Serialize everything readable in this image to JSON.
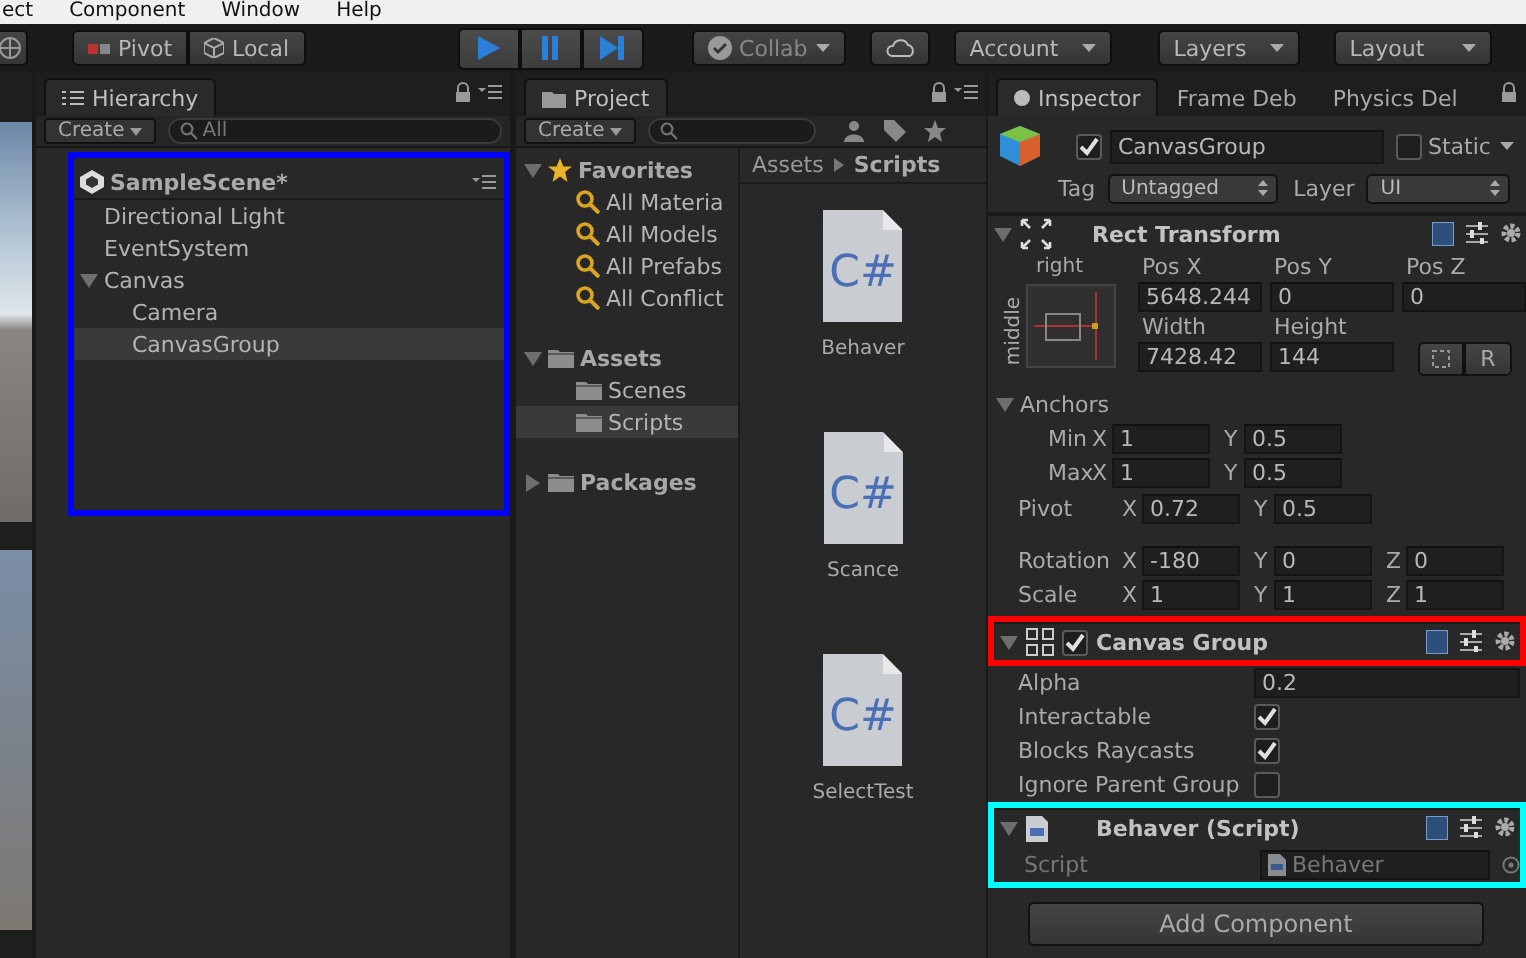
{
  "menu_bar": [
    "ect",
    "Component",
    "Window",
    "Help"
  ],
  "toolbar": {
    "pivot": "Pivot",
    "space": "Local",
    "play_controls": [
      {
        "kind": "play"
      },
      {
        "kind": "pause"
      },
      {
        "kind": "step"
      }
    ],
    "collab": "Collab",
    "account": "Account",
    "layers": "Layers",
    "layout": "Layout"
  },
  "hierarchy": {
    "tab": "Hierarchy",
    "create": "Create",
    "search_placeholder": "All",
    "scene": "SampleScene*",
    "items": [
      {
        "label": "Directional Light",
        "selected": false
      },
      {
        "label": "EventSystem",
        "selected": false
      },
      {
        "label": "Canvas",
        "selected": false,
        "expanded": true,
        "children": [
          {
            "label": "Camera",
            "selected": false
          },
          {
            "label": "CanvasGroup",
            "selected": true
          }
        ]
      }
    ]
  },
  "project": {
    "tab": "Project",
    "create": "Create",
    "tree": [
      {
        "label": "Favorites",
        "kind": "favorites",
        "selected": false,
        "expanded": true,
        "children": [
          {
            "label": "All Materia",
            "kind": "search",
            "selected": false
          },
          {
            "label": "All Models",
            "kind": "search",
            "selected": false
          },
          {
            "label": "All Prefabs",
            "kind": "search",
            "selected": false
          },
          {
            "label": "All Conflict",
            "kind": "search",
            "selected": false
          }
        ]
      },
      {
        "label": "Assets",
        "kind": "folder",
        "selected": false,
        "expanded": true,
        "children": [
          {
            "label": "Scenes",
            "kind": "folder",
            "selected": false
          },
          {
            "label": "Scripts",
            "kind": "folder",
            "selected": true
          }
        ]
      },
      {
        "label": "Packages",
        "kind": "folder",
        "selected": false,
        "expanded": false
      }
    ],
    "breadcrumb": [
      "Assets",
      "Scripts"
    ],
    "files": [
      {
        "name": "Behaver",
        "icon_label": "C#"
      },
      {
        "name": "Scance",
        "icon_label": "C#"
      },
      {
        "name": "SelectTest",
        "icon_label": "C#"
      }
    ]
  },
  "inspector": {
    "tabs": [
      {
        "label": "Inspector",
        "selected": true
      },
      {
        "label": "Frame Deb",
        "selected": false
      },
      {
        "label": "Physics Del",
        "selected": false
      }
    ],
    "object": {
      "active": true,
      "name": "CanvasGroup",
      "static": false,
      "static_label": "Static",
      "tag_label": "Tag",
      "tag": "Untagged",
      "layer_label": "Layer",
      "layer": "UI"
    },
    "rect_transform": {
      "title": "Rect Transform",
      "expanded": true,
      "anchor_horizontal": "right",
      "anchor_vertical": "middle",
      "header_fields": [
        {
          "label": "Pos X",
          "value": "5648.244"
        },
        {
          "label": "Pos Y",
          "value": "0"
        },
        {
          "label": "Pos Z",
          "value": "0"
        },
        {
          "label": "Width",
          "value": "7428.42"
        },
        {
          "label": "Height",
          "value": "144"
        }
      ],
      "raw_button": "R",
      "anchors": {
        "label": "Anchors",
        "expanded": true,
        "rows": [
          {
            "label": "Min",
            "values": [
              {
                "axis": "X",
                "value": "1"
              },
              {
                "axis": "Y",
                "value": "0.5"
              }
            ]
          },
          {
            "label": "Max",
            "values": [
              {
                "axis": "X",
                "value": "1"
              },
              {
                "axis": "Y",
                "value": "0.5"
              }
            ]
          }
        ]
      },
      "rows": [
        {
          "label": "Pivot",
          "values": [
            {
              "axis": "X",
              "value": "0.72"
            },
            {
              "axis": "Y",
              "value": "0.5"
            }
          ]
        },
        {
          "label": "Rotation",
          "values": [
            {
              "axis": "X",
              "value": "-180"
            },
            {
              "axis": "Y",
              "value": "0"
            },
            {
              "axis": "Z",
              "value": "0"
            }
          ]
        },
        {
          "label": "Scale",
          "values": [
            {
              "axis": "X",
              "value": "1"
            },
            {
              "axis": "Y",
              "value": "1"
            },
            {
              "axis": "Z",
              "value": "1"
            }
          ]
        }
      ]
    },
    "canvas_group": {
      "title": "Canvas Group",
      "expanded": true,
      "enabled": true,
      "properties": [
        {
          "label": "Alpha",
          "kind": "number",
          "value": "0.2"
        },
        {
          "label": "Interactable",
          "kind": "toggle",
          "checked": true
        },
        {
          "label": "Blocks Raycasts",
          "kind": "toggle",
          "checked": true
        },
        {
          "label": "Ignore Parent Group",
          "kind": "toggle",
          "checked": false
        }
      ]
    },
    "script_component": {
      "title": "Behaver (Script)",
      "expanded": true,
      "field_label": "Script",
      "field_value": "Behaver"
    },
    "add_component": "Add Component"
  },
  "annotations": [
    {
      "color": "#0000ff"
    },
    {
      "color": "#ff0000"
    },
    {
      "color": "#00ffff"
    }
  ]
}
